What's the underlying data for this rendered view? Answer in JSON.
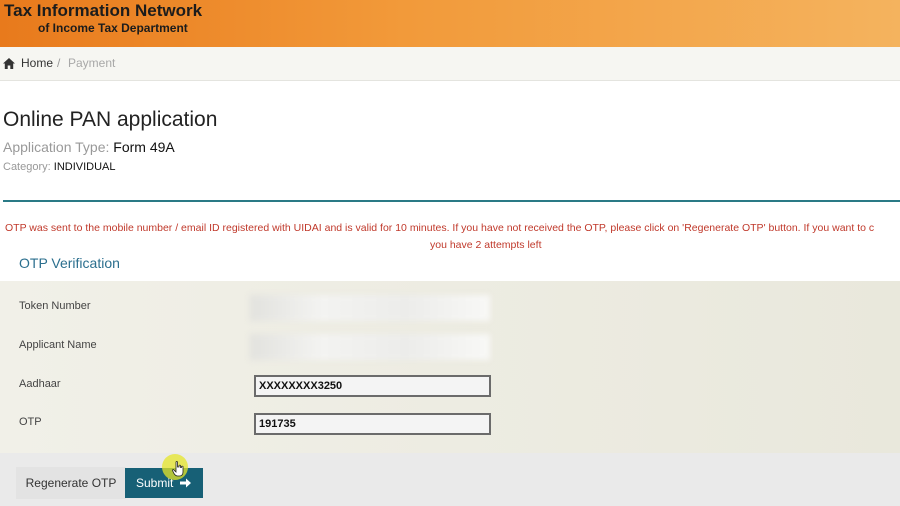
{
  "header": {
    "title": "Tax Information Network",
    "subtitle": "of Income Tax Department"
  },
  "breadcrumb": {
    "home": "Home",
    "separator": "/",
    "current": "Payment"
  },
  "page": {
    "title": "Online PAN application",
    "application_type_label": "Application Type:",
    "application_type_value": "Form 49A",
    "category_label": "Category:",
    "category_value": "INDIVIDUAL"
  },
  "alert": {
    "line1": "OTP was sent to the mobile number / email ID registered with UIDAI and is valid for 10 minutes. If you have not received the OTP, please click on 'Regenerate OTP' button. If you want to c",
    "line2": "you have 2 attempts left"
  },
  "otp_section": {
    "title": "OTP Verification",
    "fields": {
      "token_label": "Token Number",
      "name_label": "Applicant Name",
      "aadhaar_label": "Aadhaar",
      "aadhaar_value": "XXXXXXXX3250",
      "otp_label": "OTP",
      "otp_value": "191735"
    }
  },
  "buttons": {
    "regenerate": "Regenerate OTP",
    "submit": "Submit"
  },
  "colors": {
    "header_orange": "#e87a1c",
    "accent_teal": "#176076",
    "alert_red": "#c0392b",
    "section_blue": "#2b6f8e"
  },
  "icons": {
    "breadcrumb_home": "home-icon",
    "submit_arrow": "arrow-right-icon",
    "cursor": "pointer-cursor-icon"
  }
}
